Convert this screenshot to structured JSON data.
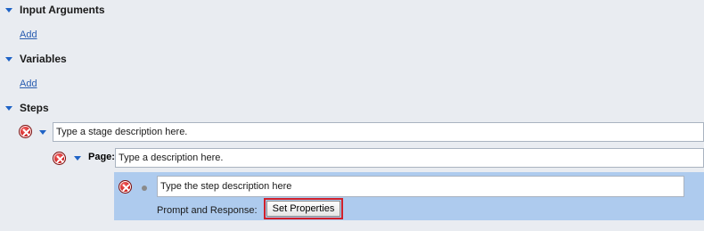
{
  "sections": {
    "input_arguments": {
      "title": "Input Arguments",
      "add_label": "Add"
    },
    "variables": {
      "title": "Variables",
      "add_label": "Add"
    },
    "steps": {
      "title": "Steps"
    }
  },
  "stage": {
    "description_placeholder": "Type a stage description here."
  },
  "page": {
    "label": "Page:",
    "description_placeholder": "Type a description here."
  },
  "step": {
    "description_placeholder": "Type the step description here",
    "prompt_label": "Prompt and Response:",
    "set_properties_label": "Set Properties"
  },
  "colors": {
    "background": "#e9ecf1",
    "selected_step": "#aecbee",
    "link": "#2a5db0",
    "chevron": "#1f63c6",
    "error": "#d21f1f",
    "highlight_border": "#d0202a"
  },
  "icons": [
    "chevron-down-icon",
    "error-icon",
    "bullet-icon"
  ]
}
